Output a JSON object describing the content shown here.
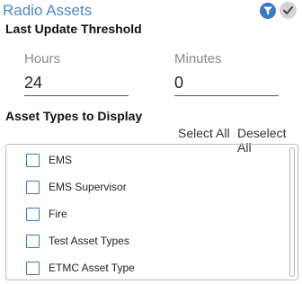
{
  "header": {
    "title": "Radio Assets",
    "filter_icon": "filter-icon",
    "check_icon": "checkmark-icon",
    "accent_color": "#3b79c4"
  },
  "threshold": {
    "label": "Last Update Threshold",
    "hours_label": "Hours",
    "hours_value": "24",
    "minutes_label": "Minutes",
    "minutes_value": "0"
  },
  "asset_types": {
    "label": "Asset Types to Display",
    "select_all": "Select All",
    "deselect_all": "Deselect All",
    "items": [
      {
        "label": "EMS",
        "checked": false
      },
      {
        "label": "EMS Supervisor",
        "checked": false
      },
      {
        "label": "Fire",
        "checked": false
      },
      {
        "label": "Test Asset Types",
        "checked": false
      },
      {
        "label": "ETMC Asset Type",
        "checked": false
      }
    ]
  }
}
